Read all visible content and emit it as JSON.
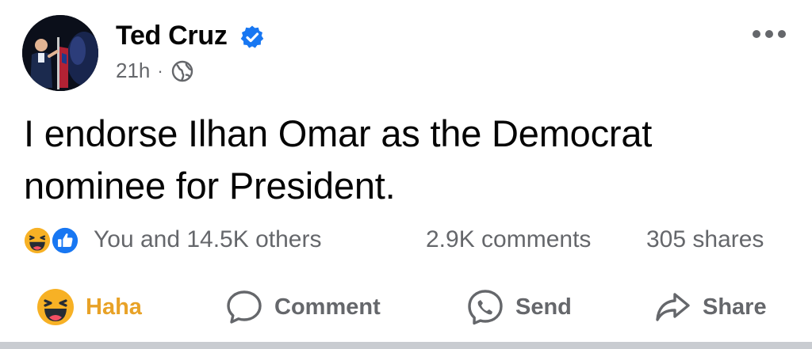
{
  "author": {
    "name": "Ted Cruz",
    "verified": true,
    "avatar_icon": "avatar-photo-speaker-on-stage"
  },
  "meta": {
    "time": "21h",
    "separator": "·",
    "audience_icon": "globe-icon"
  },
  "post": {
    "text": "I endorse Ilhan Omar as the Democrat nominee for President."
  },
  "stats": {
    "reactions_text": "You and 14.5K others",
    "comments_text": "2.9K comments",
    "shares_text": "305 shares",
    "reaction_icons": [
      "haha-icon",
      "like-icon"
    ]
  },
  "actions": {
    "haha_label": "Haha",
    "comment_label": "Comment",
    "send_label": "Send",
    "share_label": "Share"
  },
  "colors": {
    "verified_blue": "#1877f2",
    "haha_yellow": "#f7b125",
    "haha_label": "#e8a227",
    "secondary_text": "#65676b",
    "primary_text": "#050505"
  }
}
